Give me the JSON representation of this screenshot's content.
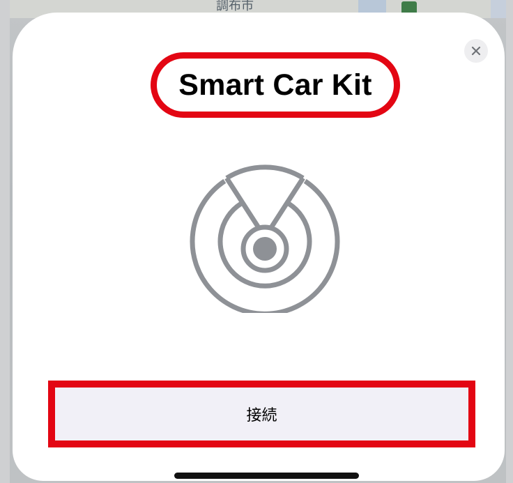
{
  "background": {
    "map_place_label": "調布市"
  },
  "sheet": {
    "title": "Smart Car Kit",
    "close_icon": "close-icon",
    "device_icon": "radar-signal-icon",
    "connect_button_label": "接続"
  },
  "colors": {
    "highlight_red": "#e30613",
    "icon_gray": "#8e9196",
    "button_bg": "#f1f0f7",
    "close_bg": "#eeeef0"
  }
}
